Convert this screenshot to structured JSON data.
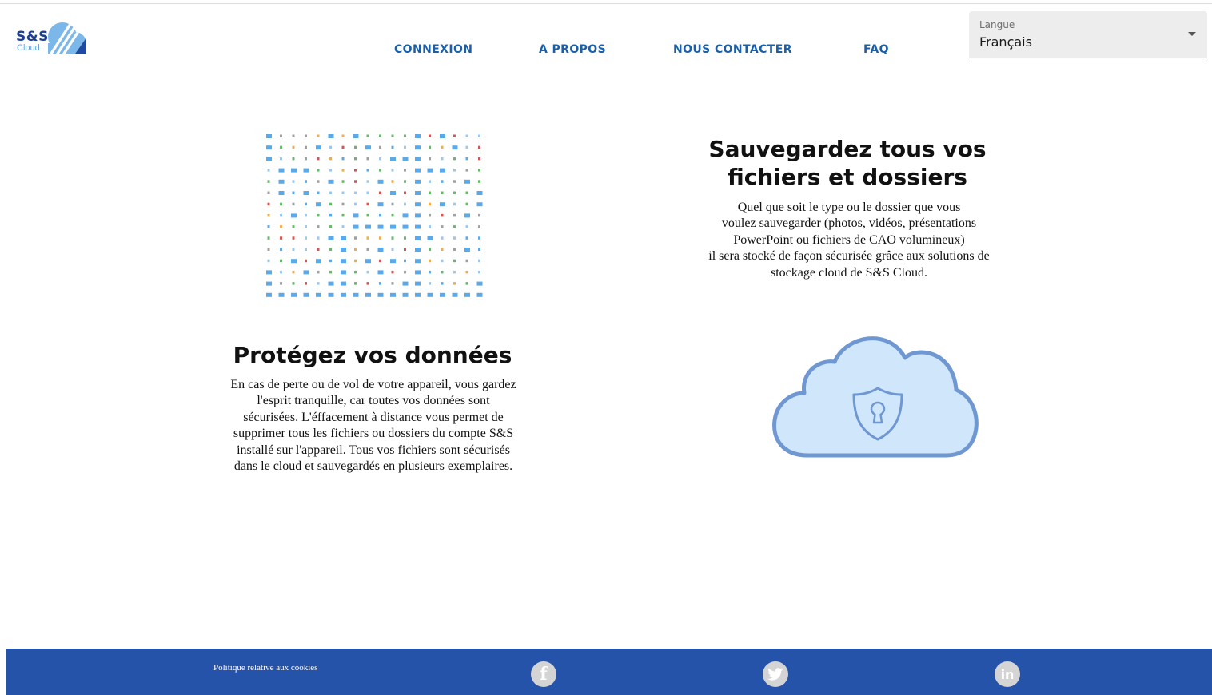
{
  "header": {
    "logo": {
      "main": "S&S",
      "sub": "Cloud"
    },
    "nav": [
      {
        "label": "CONNEXION"
      },
      {
        "label": "A PROPOS"
      },
      {
        "label": "NOUS CONTACTER"
      },
      {
        "label": "FAQ"
      }
    ],
    "language": {
      "label": "Langue",
      "value": "Français"
    }
  },
  "sections": {
    "backup": {
      "title_line1": "Sauvegardez tous vos",
      "title_line2": "fichiers et dossiers",
      "lines": [
        "Quel que soit le type ou le dossier que vous",
        "voulez sauvegarder (photos, vidéos, présentations",
        "PowerPoint ou fichiers de CAO volumineux)",
        "il sera stocké de façon sécurisée grâce aux solutions de",
        "stockage cloud de S&S Cloud."
      ]
    },
    "protect": {
      "title": "Protégez vos données",
      "lines": [
        "En cas de perte ou de vol de votre appareil, vous gardez",
        "l'esprit tranquille, car toutes vos données sont",
        "sécurisées. L'éffacement à distance vous permet de",
        "supprimer tous les fichiers ou dossiers du compte S&S",
        "installé sur l'appareil. Tous vos fichiers sont sécurisés",
        "dans le cloud et sauvegardés en plusieurs exemplaires."
      ]
    }
  },
  "footer": {
    "cookie_label": "Politique relative aux cookies",
    "social": [
      {
        "icon": "facebook-icon",
        "glyph": "f"
      },
      {
        "icon": "twitter-icon",
        "glyph": ""
      },
      {
        "icon": "linkedin-icon",
        "glyph": "in"
      }
    ]
  },
  "colors": {
    "brand": "#1e3f91",
    "nav_link": "#1b5fa8",
    "footer_bg": "#2653aa",
    "cloud_fill": "#cfe6fb",
    "cloud_stroke": "#6f98d2"
  }
}
